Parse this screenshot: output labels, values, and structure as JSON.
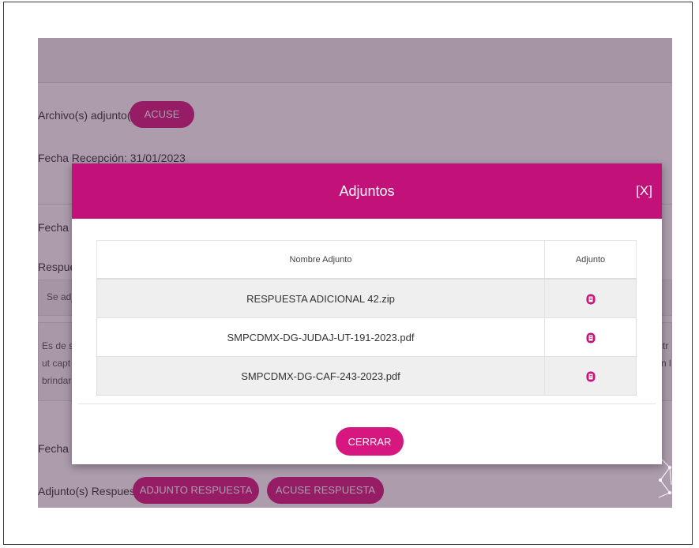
{
  "background": {
    "attachments_label": "Archivo(s) adjunto(s):",
    "acuse_button": "ACUSE",
    "received_date_label": "Fecha Recepción: 31/01/2023",
    "last_date_label_partial": "Fecha úl",
    "response_label_partial": "Respues",
    "box1_text": "Se adj",
    "box2_line1": "Es de s",
    "box2_line2": "ut capt",
    "box2_line3": "brindar",
    "right_fragment_1": "ctr",
    "right_fragment_2": "n l",
    "sent_date_label_partial": "Fecha er",
    "response_attachments_label": "Adjunto(s) Respuesta:",
    "adjunto_respuesta_button": "ADJUNTO RESPUESTA",
    "acuse_respuesta_button": "ACUSE RESPUESTA"
  },
  "modal": {
    "title": "Adjuntos",
    "close_label": "[X]",
    "table": {
      "headers": [
        "Nombre Adjunto",
        "Adjunto"
      ],
      "rows": [
        {
          "name": "RESPUESTA ADICIONAL 42.zip"
        },
        {
          "name": "SMPCDMX-DG-JUDAJ-UT-191-2023.pdf"
        },
        {
          "name": "SMPCDMX-DG-CAF-243-2023.pdf"
        }
      ]
    },
    "close_button": "CERRAR"
  },
  "colors": {
    "header_magenta": "#c2127a",
    "button_magenta": "#d5177f",
    "icon_magenta": "#c4157c"
  },
  "icons": [
    "document-icon",
    "network-graph-icon"
  ]
}
